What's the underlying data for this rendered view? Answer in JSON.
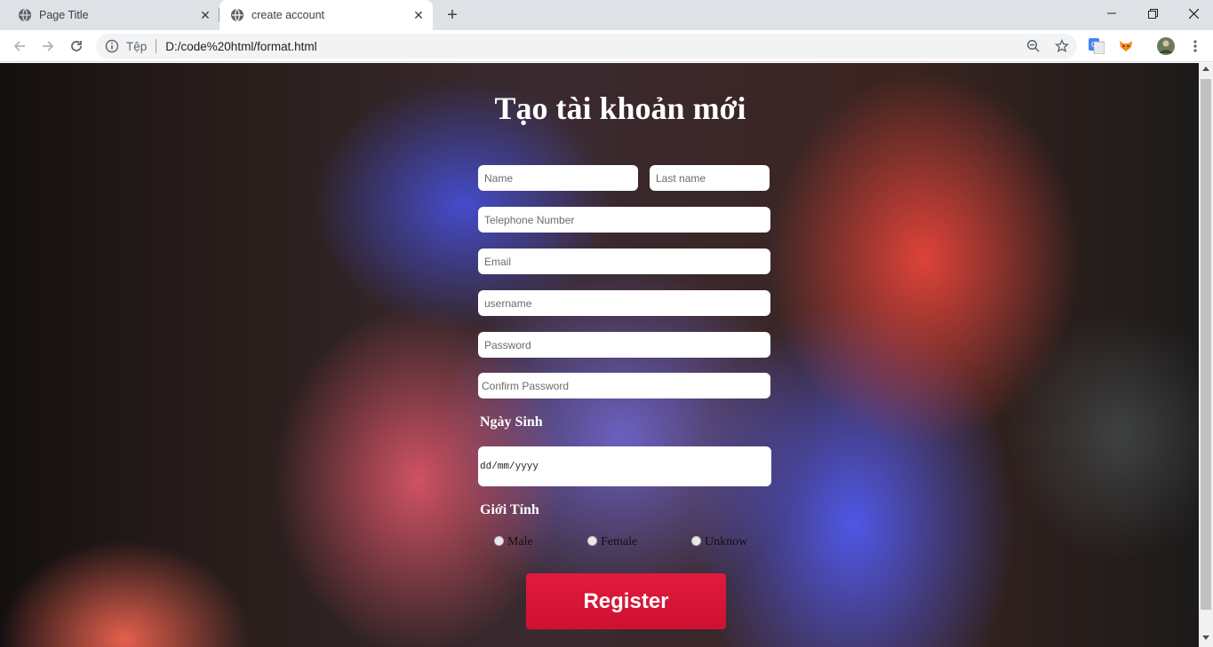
{
  "browser": {
    "tabs": [
      {
        "title": "Page Title"
      },
      {
        "title": "create account"
      }
    ],
    "address": {
      "scheme_label": "Tệp",
      "url": "D:/code%20html/format.html"
    }
  },
  "page": {
    "title": "Tạo tài khoản mới",
    "fields": {
      "name_placeholder": "Name",
      "last_name_placeholder": "Last name",
      "telephone_placeholder": "Telephone Number",
      "email_placeholder": "Email",
      "username_placeholder": "username",
      "password_placeholder": "Password",
      "confirm_password_placeholder": "Confirm Password"
    },
    "birthday_label": "Ngày Sinh",
    "birthday_value": "dd/mm/yyyy",
    "gender_label": "Giới Tính",
    "gender_options": [
      "Male",
      "Female",
      "Unknow"
    ],
    "register_label": "Register"
  }
}
